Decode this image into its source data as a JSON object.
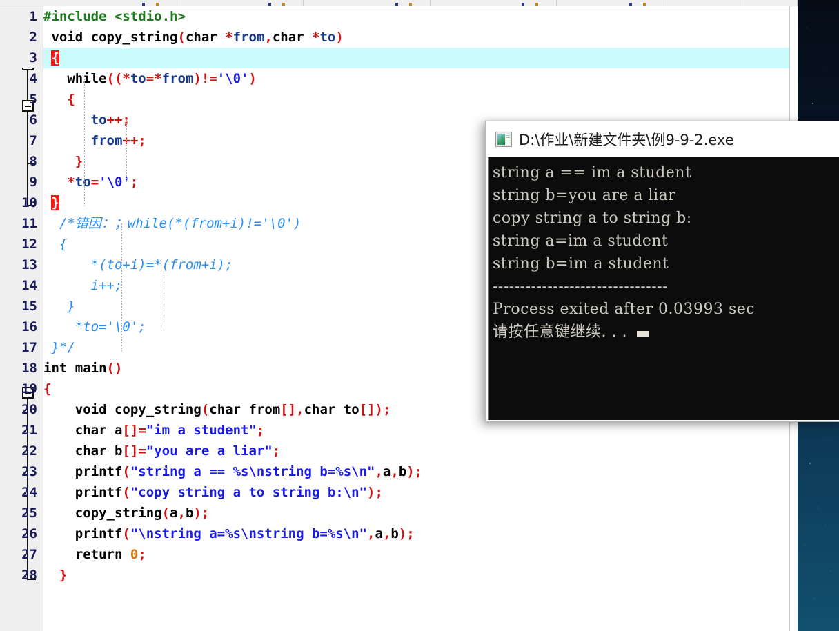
{
  "toolbar": {
    "cells": [
      280,
      200,
      200,
      200,
      170,
      120,
      90
    ]
  },
  "editor": {
    "name": "code-editor",
    "highlighted_line": 3,
    "lines": [
      {
        "n": "1",
        "tokens": [
          {
            "t": "#include <stdio.h>",
            "c": "pre"
          }
        ],
        "indent": 0
      },
      {
        "n": "2",
        "tokens": [
          {
            "t": " ",
            "c": "plain"
          },
          {
            "t": "void",
            "c": "kw"
          },
          {
            "t": " copy_string",
            "c": "fn"
          },
          {
            "t": "(",
            "c": "op"
          },
          {
            "t": "char",
            "c": "kw"
          },
          {
            "t": " *",
            "c": "op"
          },
          {
            "t": "from",
            "c": "id"
          },
          {
            "t": ",",
            "c": "op"
          },
          {
            "t": "char",
            "c": "kw"
          },
          {
            "t": " *",
            "c": "op"
          },
          {
            "t": "to",
            "c": "id"
          },
          {
            "t": ")",
            "c": "op"
          }
        ],
        "indent": 0
      },
      {
        "n": "3",
        "tokens": [
          {
            "t": " ",
            "c": "plain"
          },
          {
            "t": "{",
            "c": "brace-hl"
          }
        ],
        "indent": 0
      },
      {
        "n": "4",
        "tokens": [
          {
            "t": "   ",
            "c": "plain"
          },
          {
            "t": "while",
            "c": "kw"
          },
          {
            "t": "((*",
            "c": "op"
          },
          {
            "t": "to",
            "c": "id"
          },
          {
            "t": "=*",
            "c": "op"
          },
          {
            "t": "from",
            "c": "id"
          },
          {
            "t": ")!=",
            "c": "op"
          },
          {
            "t": "'\\0'",
            "c": "str"
          },
          {
            "t": ")",
            "c": "op"
          }
        ],
        "indent": 0
      },
      {
        "n": "5",
        "tokens": [
          {
            "t": "   ",
            "c": "plain"
          },
          {
            "t": "{",
            "c": "op"
          }
        ],
        "indent": 0
      },
      {
        "n": "6",
        "tokens": [
          {
            "t": "      ",
            "c": "plain"
          },
          {
            "t": "to",
            "c": "id"
          },
          {
            "t": "++;",
            "c": "op"
          }
        ],
        "indent": 0
      },
      {
        "n": "7",
        "tokens": [
          {
            "t": "      ",
            "c": "plain"
          },
          {
            "t": "from",
            "c": "id"
          },
          {
            "t": "++;",
            "c": "op"
          }
        ],
        "indent": 0
      },
      {
        "n": "8",
        "tokens": [
          {
            "t": "    ",
            "c": "plain"
          },
          {
            "t": "}",
            "c": "op"
          }
        ],
        "indent": 0
      },
      {
        "n": "9",
        "tokens": [
          {
            "t": "   ",
            "c": "plain"
          },
          {
            "t": "*",
            "c": "op"
          },
          {
            "t": "to",
            "c": "id"
          },
          {
            "t": "=",
            "c": "op"
          },
          {
            "t": "'\\0'",
            "c": "str"
          },
          {
            "t": ";",
            "c": "op"
          }
        ],
        "indent": 0
      },
      {
        "n": "10",
        "tokens": [
          {
            "t": " ",
            "c": "plain"
          },
          {
            "t": "}",
            "c": "brace-hl"
          }
        ],
        "indent": 0
      },
      {
        "n": "11",
        "tokens": [
          {
            "t": "  /*错因：；while(*(from+i)!='\\0')",
            "c": "cmt"
          }
        ],
        "indent": 0
      },
      {
        "n": "12",
        "tokens": [
          {
            "t": "  {",
            "c": "cmt"
          }
        ],
        "indent": 0
      },
      {
        "n": "13",
        "tokens": [
          {
            "t": "      *(to+i)=*(from+i);",
            "c": "cmt"
          }
        ],
        "indent": 0
      },
      {
        "n": "14",
        "tokens": [
          {
            "t": "      i++;",
            "c": "cmt"
          }
        ],
        "indent": 0
      },
      {
        "n": "15",
        "tokens": [
          {
            "t": "   }",
            "c": "cmt"
          }
        ],
        "indent": 0
      },
      {
        "n": "16",
        "tokens": [
          {
            "t": "    *to='\\0';",
            "c": "cmt"
          }
        ],
        "indent": 0
      },
      {
        "n": "17",
        "tokens": [
          {
            "t": " }*/",
            "c": "cmt"
          }
        ],
        "indent": 0
      },
      {
        "n": "18",
        "tokens": [
          {
            "t": "int",
            "c": "kw"
          },
          {
            "t": " main",
            "c": "fn"
          },
          {
            "t": "()",
            "c": "op"
          }
        ],
        "indent": 0
      },
      {
        "n": "19",
        "tokens": [
          {
            "t": "{",
            "c": "op"
          }
        ],
        "indent": 0
      },
      {
        "n": "20",
        "tokens": [
          {
            "t": "    ",
            "c": "plain"
          },
          {
            "t": "void",
            "c": "kw"
          },
          {
            "t": " copy_string",
            "c": "fn"
          },
          {
            "t": "(",
            "c": "op"
          },
          {
            "t": "char",
            "c": "kw"
          },
          {
            "t": " from",
            "c": "fn"
          },
          {
            "t": "[],",
            "c": "op"
          },
          {
            "t": "char",
            "c": "kw"
          },
          {
            "t": " to",
            "c": "fn"
          },
          {
            "t": "[]);",
            "c": "op"
          }
        ],
        "indent": 0
      },
      {
        "n": "21",
        "tokens": [
          {
            "t": "    ",
            "c": "plain"
          },
          {
            "t": "char",
            "c": "kw"
          },
          {
            "t": " a",
            "c": "fn"
          },
          {
            "t": "[]",
            "c": "op"
          },
          {
            "t": "=",
            "c": "op"
          },
          {
            "t": "\"im a student\"",
            "c": "str"
          },
          {
            "t": ";",
            "c": "op"
          }
        ],
        "indent": 0
      },
      {
        "n": "22",
        "tokens": [
          {
            "t": "    ",
            "c": "plain"
          },
          {
            "t": "char",
            "c": "kw"
          },
          {
            "t": " b",
            "c": "fn"
          },
          {
            "t": "[]",
            "c": "op"
          },
          {
            "t": "=",
            "c": "op"
          },
          {
            "t": "\"you are a liar\"",
            "c": "str"
          },
          {
            "t": ";",
            "c": "op"
          }
        ],
        "indent": 0
      },
      {
        "n": "23",
        "tokens": [
          {
            "t": "    ",
            "c": "plain"
          },
          {
            "t": "printf",
            "c": "fn"
          },
          {
            "t": "(",
            "c": "op"
          },
          {
            "t": "\"string a == %s\\nstring b=%s\\n\"",
            "c": "str"
          },
          {
            "t": ",",
            "c": "op"
          },
          {
            "t": "a",
            "c": "fn"
          },
          {
            "t": ",",
            "c": "op"
          },
          {
            "t": "b",
            "c": "fn"
          },
          {
            "t": ");",
            "c": "op"
          }
        ],
        "indent": 0
      },
      {
        "n": "24",
        "tokens": [
          {
            "t": "    ",
            "c": "plain"
          },
          {
            "t": "printf",
            "c": "fn"
          },
          {
            "t": "(",
            "c": "op"
          },
          {
            "t": "\"copy string a to string b:\\n\"",
            "c": "str"
          },
          {
            "t": ");",
            "c": "op"
          }
        ],
        "indent": 0
      },
      {
        "n": "25",
        "tokens": [
          {
            "t": "    copy_string",
            "c": "fn"
          },
          {
            "t": "(",
            "c": "op"
          },
          {
            "t": "a",
            "c": "fn"
          },
          {
            "t": ",",
            "c": "op"
          },
          {
            "t": "b",
            "c": "fn"
          },
          {
            "t": ");",
            "c": "op"
          }
        ],
        "indent": 0
      },
      {
        "n": "26",
        "tokens": [
          {
            "t": "    ",
            "c": "plain"
          },
          {
            "t": "printf",
            "c": "fn"
          },
          {
            "t": "(",
            "c": "op"
          },
          {
            "t": "\"\\nstring a=%s\\nstring b=%s\\n\"",
            "c": "str"
          },
          {
            "t": ",",
            "c": "op"
          },
          {
            "t": "a",
            "c": "fn"
          },
          {
            "t": ",",
            "c": "op"
          },
          {
            "t": "b",
            "c": "fn"
          },
          {
            "t": ");",
            "c": "op"
          }
        ],
        "indent": 0
      },
      {
        "n": "27",
        "tokens": [
          {
            "t": "    ",
            "c": "plain"
          },
          {
            "t": "return",
            "c": "kw"
          },
          {
            "t": " ",
            "c": "plain"
          },
          {
            "t": "0",
            "c": "num"
          },
          {
            "t": ";",
            "c": "op"
          }
        ],
        "indent": 0
      },
      {
        "n": "28",
        "tokens": [
          {
            "t": "  ",
            "c": "plain"
          },
          {
            "t": "}",
            "c": "op"
          }
        ],
        "indent": 0
      }
    ]
  },
  "console": {
    "title": "D:\\作业\\新建文件夹\\例9-9-2.exe",
    "icon": "console-app-icon",
    "output": [
      "string a == im a student",
      "string b=you are a liar",
      "copy string a to string b:",
      "",
      "string a=im a student",
      "string b=im a student",
      "",
      "--------------------------------",
      "Process exited after 0.03993 sec",
      "请按任意键继续. . ."
    ]
  }
}
